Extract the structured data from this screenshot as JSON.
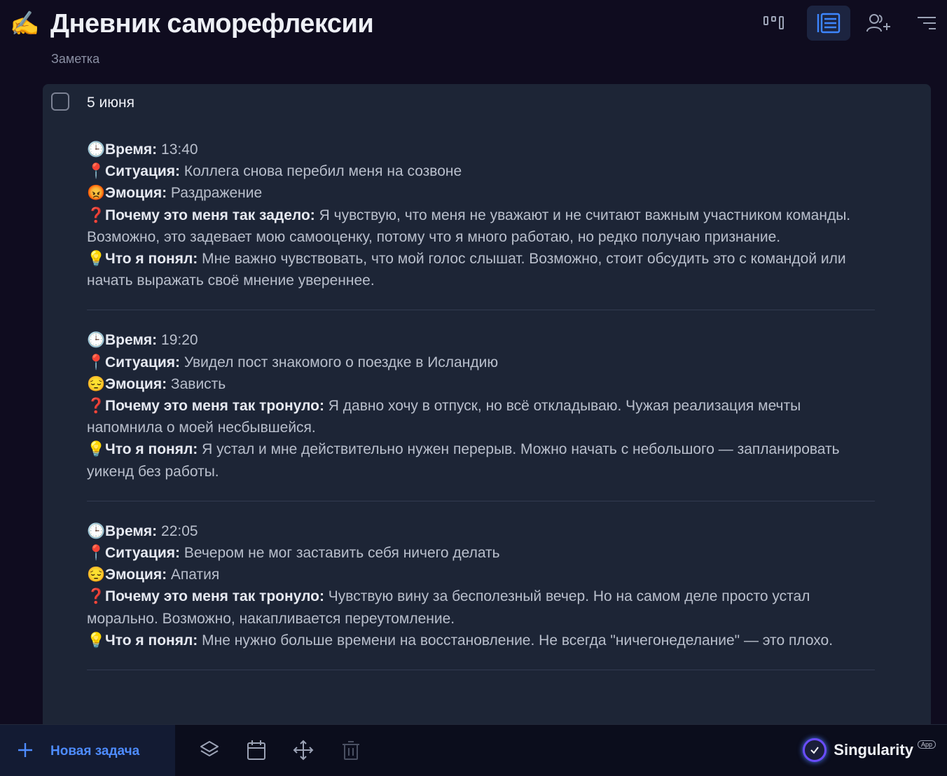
{
  "header": {
    "title_emoji": "✍️",
    "title": "Дневник саморефлексии",
    "subtitle": "Заметка",
    "view_buttons": [
      "board-view-icon",
      "list-view-icon",
      "add-user-icon",
      "filter-sort-icon"
    ],
    "active_view": "list-view-icon"
  },
  "task": {
    "title": "5 июня",
    "checked": false,
    "entries": [
      {
        "time_emoji": "🕒",
        "time_label": "Время:",
        "time": " 13:40",
        "situation_emoji": "📍",
        "situation_label": "Ситуация:",
        "situation": " Коллега снова перебил меня на созвоне",
        "emotion_emoji": "😡",
        "emotion_label": "Эмоция:",
        "emotion": " Раздражение",
        "why_emoji": "❓",
        "why_label": "Почему это меня так задело:",
        "why": " Я чувствую, что меня не уважают и не считают важным участником команды. Возможно, это задевает мою самооценку, потому что я много работаю, но редко получаю признание.",
        "insight_emoji": "💡",
        "insight_label": "Что я понял:",
        "insight": " Мне важно чувствовать, что мой голос слышат. Возможно, стоит обсудить это с командой или начать выражать своё мнение увереннее."
      },
      {
        "time_emoji": "🕒",
        "time_label": "Время:",
        "time": " 19:20",
        "situation_emoji": "📍",
        "situation_label": "Ситуация:",
        "situation": " Увидел пост знакомого о поездке в Исландию",
        "emotion_emoji": "😔",
        "emotion_label": "Эмоция:",
        "emotion": " Зависть",
        "why_emoji": "❓",
        "why_label": "Почему это меня так тронуло:",
        "why": " Я давно хочу в отпуск, но всё откладываю. Чужая реализация мечты напомнила о моей несбывшейся.",
        "insight_emoji": "💡",
        "insight_label": "Что я понял:",
        "insight": " Я устал и мне действительно нужен перерыв. Можно начать с небольшого — запланировать уикенд без работы."
      },
      {
        "time_emoji": "🕒",
        "time_label": "Время:",
        "time": " 22:05",
        "situation_emoji": "📍",
        "situation_label": "Ситуация:",
        "situation": " Вечером не мог заставить себя ничего делать",
        "emotion_emoji": "😔",
        "emotion_label": "Эмоция:",
        "emotion": " Апатия",
        "why_emoji": "❓",
        "why_label": "Почему это меня так тронуло:",
        "why": " Чувствую вину за бесполезный вечер. Но на самом деле просто устал морально. Возможно, накапливается переутомление.",
        "insight_emoji": "💡",
        "insight_label": "Что я понял:",
        "insight": " Мне нужно больше времени на восстановление. Не всегда \"ничегонеделание\" — это плохо."
      }
    ]
  },
  "footer": {
    "new_task_label": "Новая задача",
    "tools": [
      "layers-icon",
      "calendar-icon",
      "move-icon",
      "trash-icon"
    ],
    "brand_name": "Singularity",
    "brand_tag": "App"
  },
  "colors": {
    "background": "#0f0c1f",
    "card": "#1d2536",
    "accent": "#4e8cff"
  }
}
